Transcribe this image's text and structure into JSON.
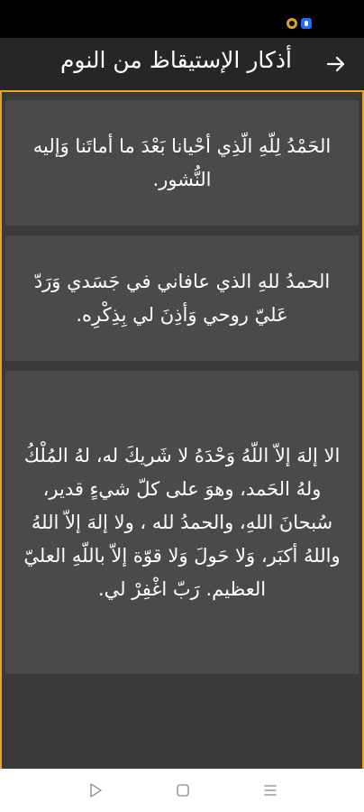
{
  "status_bar": {
    "icons": [
      "amber-notification-icon",
      "blue-notification-icon"
    ]
  },
  "toolbar": {
    "title": "أذكار الإستيقاظ من النوم",
    "back_icon": "arrow-right-icon"
  },
  "cards": [
    {
      "text": "الحَمْدُ لِلّهِ الّذِي أحْيانا بَعْدَ ما أماتَنا وَإليه النُّشور."
    },
    {
      "text": "الحمدُ للهِ الذي عافاني في جَسَدي وَرَدّ عَليّ روحي وَأذِنَ لي بِذِكْرِه."
    },
    {
      "text": "الا إلهَ إلاّ اللّهُ وَحْدَهُ لا شَريكَ له، لهُ المُلْكُ ولهُ الحَمد، وهوَ على كلّ شيءٍ قدير، سُبحانَ اللهِ، والحمدُ لله ، ولا إلهَ إلاّ اللهُ واللهُ أكبَر، وَلا حَولَ وَلا قوّة إلاّ باللّهِ العليّ العظيم. رَبّ اغْفِرْ لي."
    }
  ],
  "nav_bar": {
    "buttons": [
      "back-triangle-icon",
      "home-square-icon",
      "recents-menu-icon"
    ]
  },
  "colors": {
    "accent": "#f0a020",
    "toolbar_bg": "#262626",
    "content_bg": "#3a3a3a",
    "card_bg": "#4a4a4a",
    "text": "#ffffff"
  }
}
